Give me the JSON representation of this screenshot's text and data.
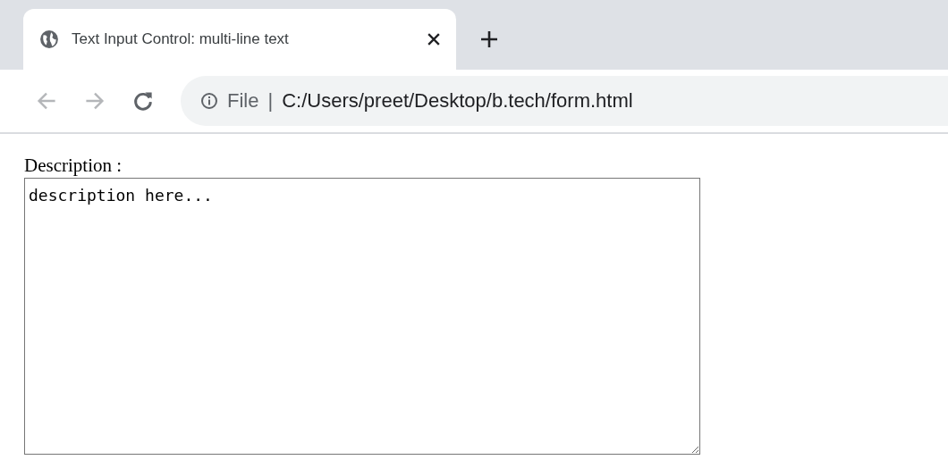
{
  "tabs": [
    {
      "title": "Text Input Control: multi-line text",
      "selected": true
    }
  ],
  "toolbar": {
    "buttons": [
      {
        "kind": "back",
        "disabled": true
      },
      {
        "kind": "forward",
        "disabled": true
      },
      {
        "kind": "reload",
        "disabled": false
      }
    ]
  },
  "address_bar": {
    "scheme_label": "File",
    "separator": "|",
    "url": "C:/Users/preet/Desktop/b.tech/form.html"
  },
  "form": {
    "label": "Description :",
    "textarea": {
      "value": "description here..."
    }
  }
}
